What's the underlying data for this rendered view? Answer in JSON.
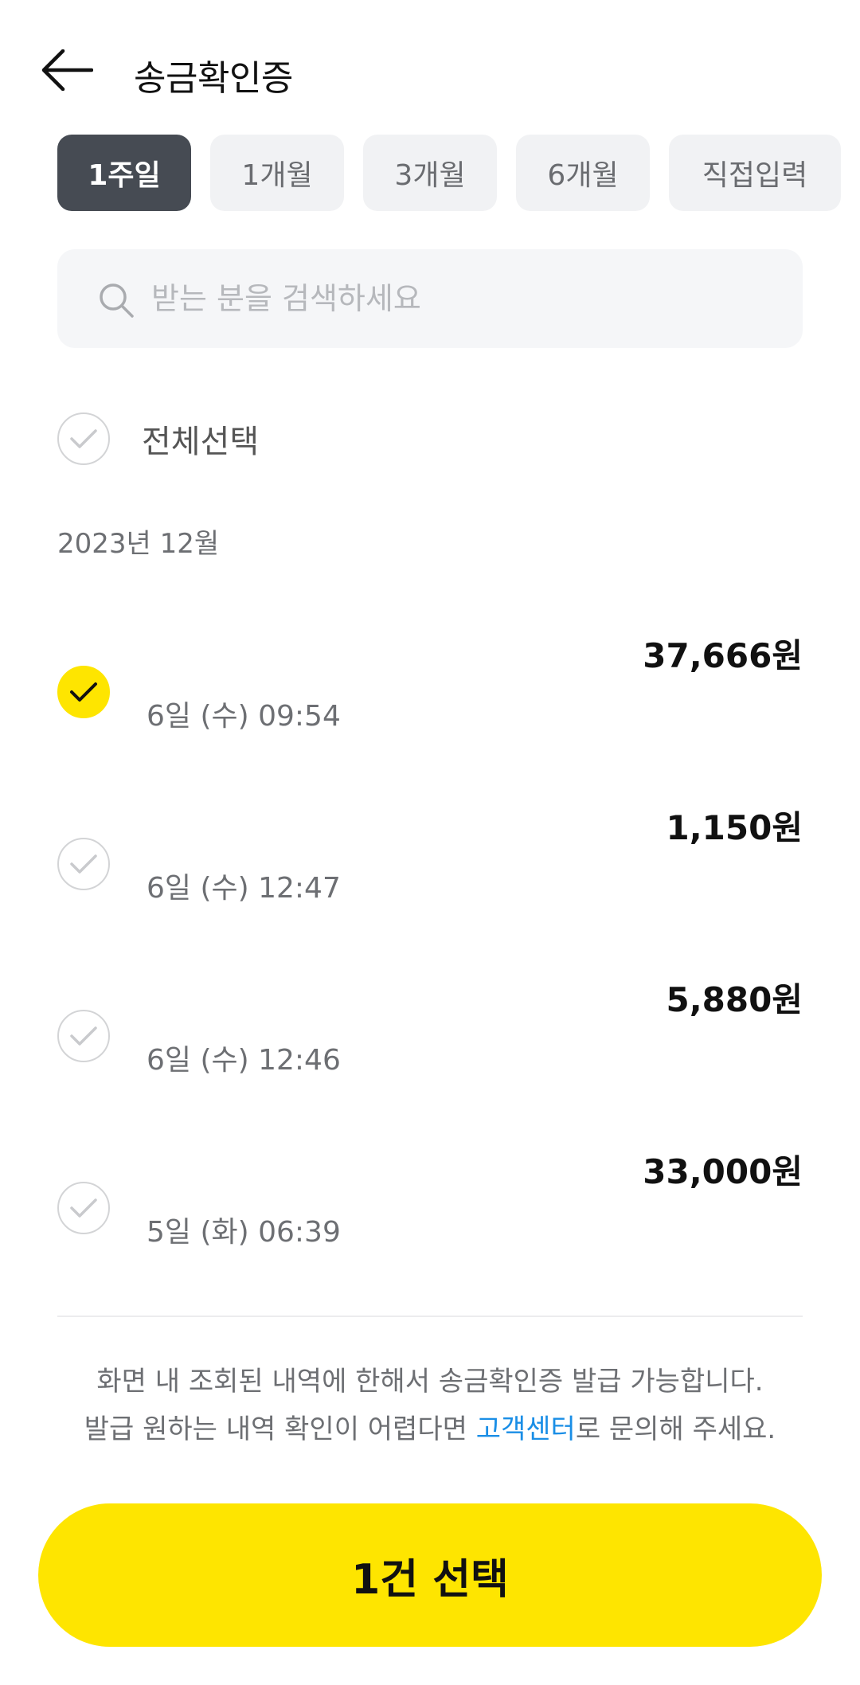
{
  "header": {
    "title": "송금확인증"
  },
  "tabs": [
    {
      "label": "1주일",
      "active": true
    },
    {
      "label": "1개월",
      "active": false
    },
    {
      "label": "3개월",
      "active": false
    },
    {
      "label": "6개월",
      "active": false
    },
    {
      "label": "직접입력",
      "active": false
    }
  ],
  "search": {
    "placeholder": "받는 분을 검색하세요",
    "value": ""
  },
  "select_all": {
    "label": "전체선택",
    "checked": false
  },
  "month_group": {
    "label": "2023년 12월"
  },
  "transactions": [
    {
      "name": "",
      "date": "6일 (수) 09:54",
      "amount": "37,666원",
      "checked": true
    },
    {
      "name": "",
      "date": "6일 (수) 12:47",
      "amount": "1,150원",
      "checked": false
    },
    {
      "name": "",
      "date": "6일 (수) 12:46",
      "amount": "5,880원",
      "checked": false
    },
    {
      "name": "",
      "date": "5일 (화) 06:39",
      "amount": "33,000원",
      "checked": false
    }
  ],
  "notice": {
    "line1": "화면 내 조회된 내역에 한해서 송금확인증 발급 가능합니다.",
    "line2_prefix": "발급 원하는 내역 확인이 어렵다면 ",
    "line2_link": "고객센터",
    "line2_suffix": "로 문의해 주세요."
  },
  "cta": {
    "label": "1건 선택"
  },
  "colors": {
    "accent_yellow": "#fee500",
    "active_tab": "#464b53",
    "link_blue": "#1a8ee6"
  },
  "icons": {
    "back": "arrow-left-icon",
    "search": "search-icon",
    "check": "check-icon"
  }
}
